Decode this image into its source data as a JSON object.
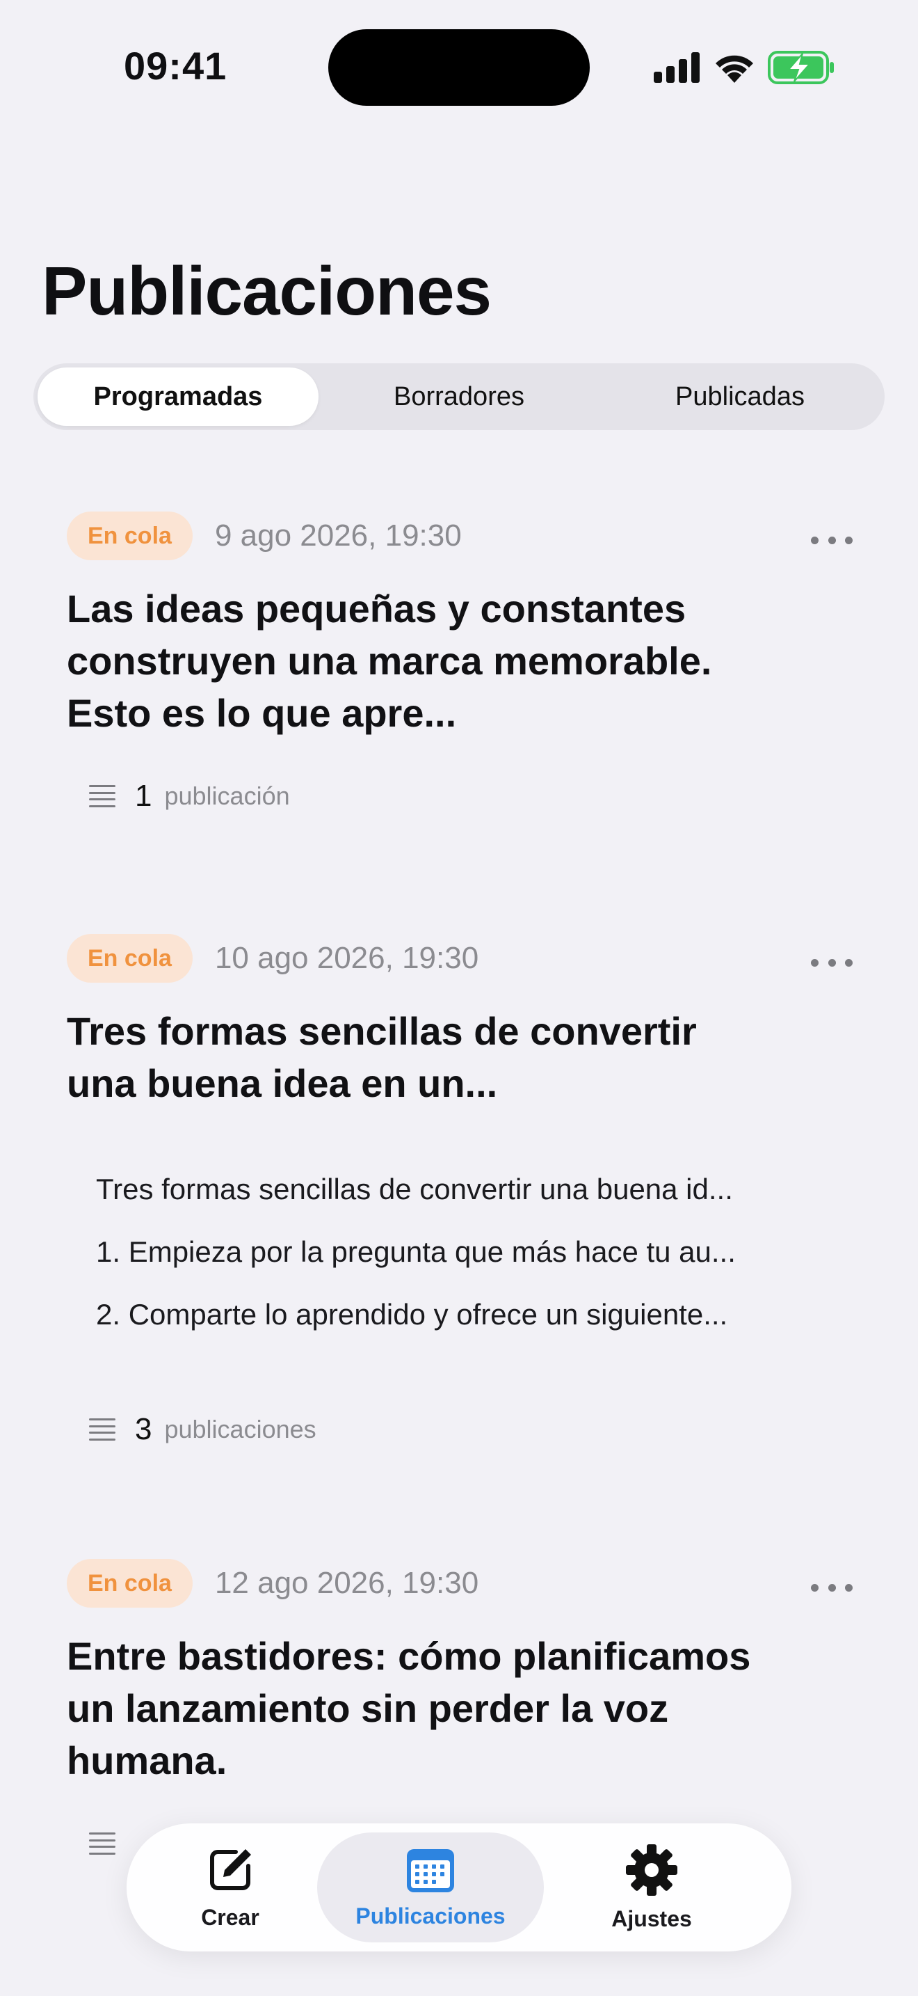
{
  "status_bar": {
    "time": "09:41"
  },
  "header": {
    "title": "Publicaciones"
  },
  "segments": [
    {
      "label": "Programadas",
      "selected": true
    },
    {
      "label": "Borradores",
      "selected": false
    },
    {
      "label": "Publicadas",
      "selected": false
    }
  ],
  "posts": [
    {
      "status": "En cola",
      "date": "9 ago 2026, 19:30",
      "title": "Las ideas pequeñas y constantes construyen una marca memorable. Esto es lo que apre...",
      "lines": [],
      "count": "1",
      "count_label": "publicación"
    },
    {
      "status": "En cola",
      "date": "10 ago 2026, 19:30",
      "title": "Tres formas sencillas de convertir una buena idea en un...",
      "lines": [
        "Tres formas sencillas de convertir una buena id...",
        "1. Empieza por la pregunta que más hace tu au...",
        "2. Comparte lo aprendido y ofrece un siguiente..."
      ],
      "count": "3",
      "count_label": "publicaciones"
    },
    {
      "status": "En cola",
      "date": "12 ago 2026, 19:30",
      "title": "Entre bastidores: cómo planificamos un lanzamiento sin perder la voz humana.",
      "lines": []
    }
  ],
  "tab_bar": {
    "items": [
      {
        "label": "Crear",
        "icon": "compose-icon"
      },
      {
        "label": "Publicaciones",
        "icon": "calendar-icon",
        "selected": true
      },
      {
        "label": "Ajustes",
        "icon": "gear-icon"
      }
    ]
  },
  "colors": {
    "background": "#f2f1f6",
    "badge_bg": "#fbe4d4",
    "badge_text": "#f0923e",
    "accent": "#2d84e0",
    "battery": "#3cc65c"
  }
}
